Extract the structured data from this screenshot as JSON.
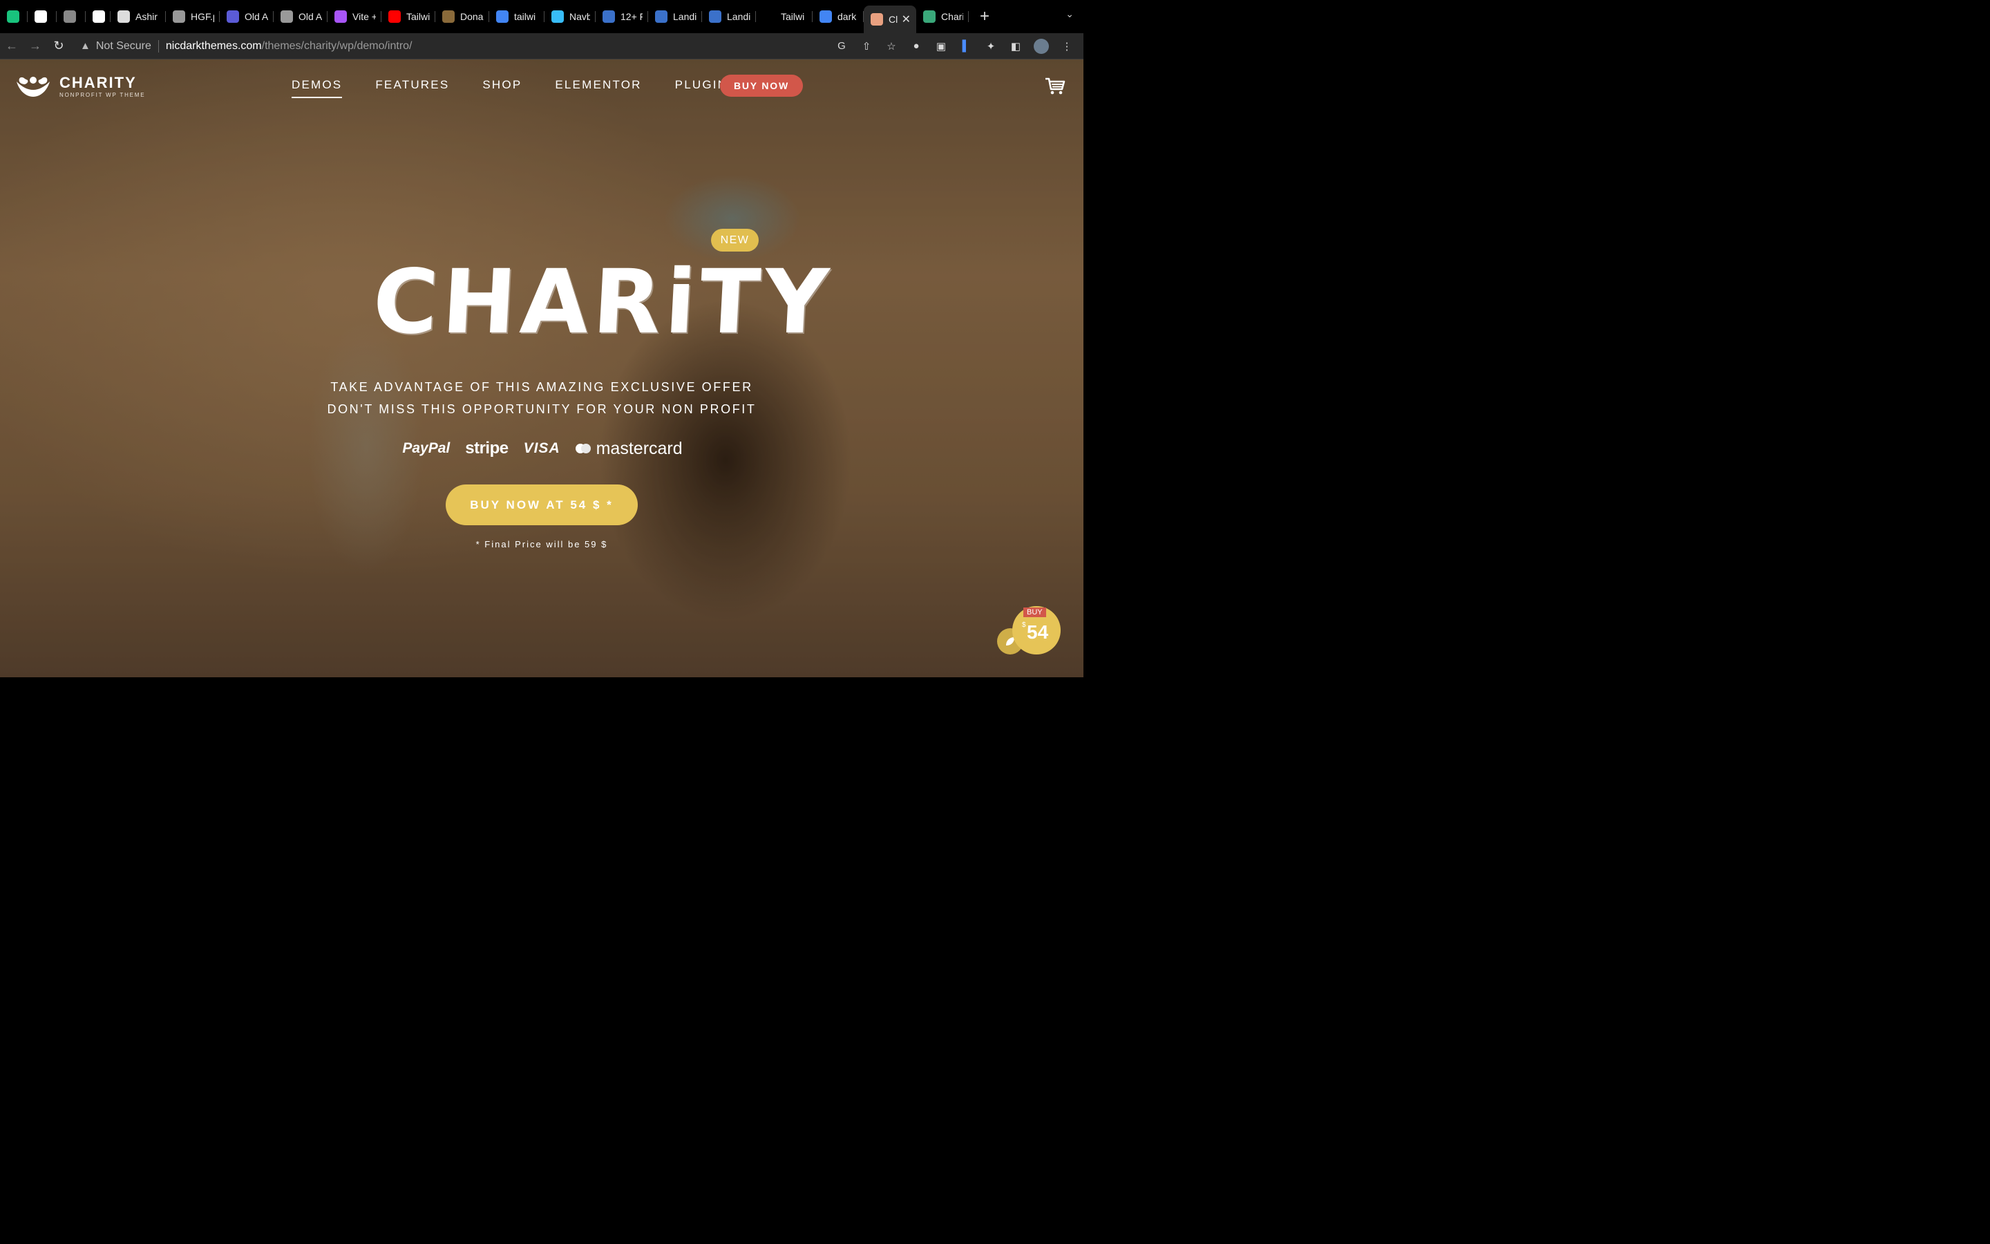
{
  "browser": {
    "tabs": [
      {
        "label": "",
        "icon": "chatgpt-icon",
        "color": "#19c37d"
      },
      {
        "label": "",
        "icon": "notion-icon",
        "color": "#ffffff"
      },
      {
        "label": "",
        "icon": "elephant-icon",
        "color": "#888888"
      },
      {
        "label": "",
        "icon": "notion-icon",
        "color": "#ffffff"
      },
      {
        "label": "Ashir",
        "icon": "page-icon",
        "color": "#dddddd"
      },
      {
        "label": "HGF.p",
        "icon": "globe-icon",
        "color": "#999999"
      },
      {
        "label": "Old A",
        "icon": "globe-icon",
        "color": "#5b5bd6"
      },
      {
        "label": "Old A",
        "icon": "globe-icon",
        "color": "#999999"
      },
      {
        "label": "Vite +",
        "icon": "vite-icon",
        "color": "#a855f7"
      },
      {
        "label": "Tailwi",
        "icon": "youtube-icon",
        "color": "#ff0000"
      },
      {
        "label": "Donal",
        "icon": "image-icon",
        "color": "#8a6a3a"
      },
      {
        "label": "tailwi",
        "icon": "google-icon",
        "color": "#4285f4"
      },
      {
        "label": "Navb",
        "icon": "leaf-icon",
        "color": "#38bdf8"
      },
      {
        "label": "12+ F",
        "icon": "te-icon",
        "color": "#3b71ca"
      },
      {
        "label": "Landi",
        "icon": "mdb-icon",
        "color": "#3b71ca"
      },
      {
        "label": "Landi",
        "icon": "mdb-icon",
        "color": "#3b71ca"
      },
      {
        "label": "Tailwi",
        "icon": "blank-icon",
        "color": "#000000"
      },
      {
        "label": "dark t",
        "icon": "google-icon",
        "color": "#4285f4"
      },
      {
        "label": "Cl",
        "icon": "charity-favicon-icon",
        "color": "#e8a080",
        "active": true
      },
      {
        "label": "Chari",
        "icon": "charity-favicon-icon",
        "color": "#3aa87a"
      }
    ],
    "security_label": "Not Secure",
    "url_host": "nicdarkthemes.com",
    "url_path": "/themes/charity/wp/demo/intro/"
  },
  "site": {
    "logo_title": "CHARITY",
    "logo_subtitle": "NONPROFIT WP THEME",
    "nav": [
      "DEMOS",
      "FEATURES",
      "SHOP",
      "ELEMENTOR",
      "PLUGINS"
    ],
    "buy_now_label": "BUY NOW"
  },
  "hero": {
    "badge": "NEW",
    "title": "CHARiTY",
    "line1": "TAKE ADVANTAGE OF THIS AMAZING EXCLUSIVE OFFER",
    "line2": "DON'T MISS THIS OPPORTUNITY FOR YOUR NON PROFIT",
    "payments": [
      "PayPal",
      "stripe",
      "VISA",
      "mastercard"
    ],
    "cta_label": "BUY NOW AT 54 $ *",
    "final_price_note": "* Final Price will be 59 $"
  },
  "float_badge": {
    "tag": "BUY",
    "currency": "$",
    "price": "54"
  },
  "colors": {
    "accent_red": "#d2574a",
    "accent_yellow": "#e6c457",
    "badge_yellow": "#e1be4f"
  }
}
